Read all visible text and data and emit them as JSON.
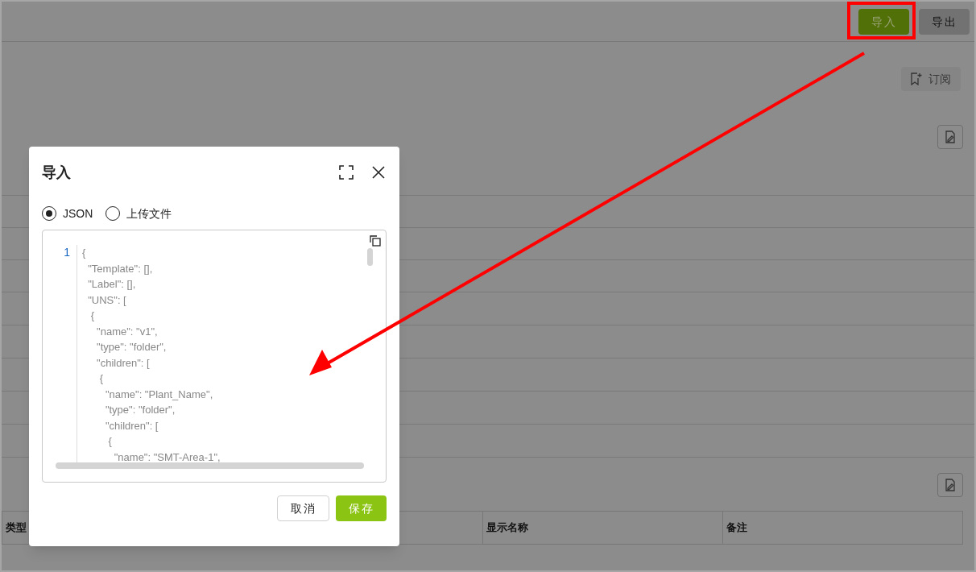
{
  "header": {
    "buttons": [
      {
        "label": "导入",
        "kind": "primary",
        "highlighted": true
      },
      {
        "label": "导出",
        "kind": "default",
        "highlighted": false
      }
    ]
  },
  "subscribe_button": {
    "label": "订阅"
  },
  "table": {
    "columns": [
      "类型",
      "",
      "显示名称",
      "备注"
    ]
  },
  "dialog": {
    "title": "导入",
    "source_options": [
      {
        "label": "JSON",
        "selected": true
      },
      {
        "label": "上传文件",
        "selected": false
      }
    ],
    "editor": {
      "line_numbers": [
        "1"
      ],
      "code_lines": [
        "{",
        "  \"Template\": [],",
        "  \"Label\": [],",
        "  \"UNS\": [",
        "   {",
        "     \"name\": \"v1\",",
        "     \"type\": \"folder\",",
        "     \"children\": [",
        "      {",
        "        \"name\": \"Plant_Name\",",
        "        \"type\": \"folder\",",
        "        \"children\": [",
        "         {",
        "           \"name\": \"SMT-Area-1\","
      ]
    },
    "buttons": [
      {
        "label": "取消",
        "kind": "default"
      },
      {
        "label": "保存",
        "kind": "primary"
      }
    ]
  }
}
